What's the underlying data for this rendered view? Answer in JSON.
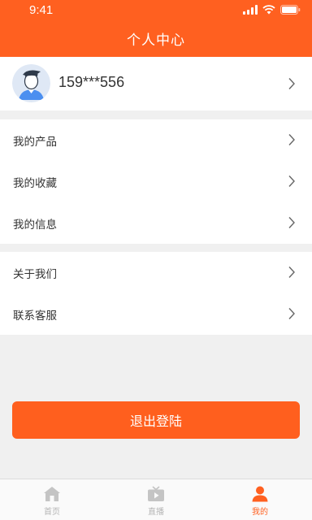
{
  "status_bar": {
    "time": "9:41"
  },
  "header": {
    "title": "个人中心"
  },
  "profile": {
    "phone": "159***556"
  },
  "menu_group_1": {
    "items": [
      {
        "label": "我的产品"
      },
      {
        "label": "我的收藏"
      },
      {
        "label": "我的信息"
      }
    ]
  },
  "menu_group_2": {
    "items": [
      {
        "label": "关于我们"
      },
      {
        "label": "联系客服"
      }
    ]
  },
  "logout": {
    "label": "退出登陆"
  },
  "tab_bar": {
    "tabs": [
      {
        "label": "首页",
        "icon": "home-icon",
        "active": false
      },
      {
        "label": "直播",
        "icon": "tv-icon",
        "active": false
      },
      {
        "label": "我的",
        "icon": "user-icon",
        "active": true
      }
    ]
  },
  "colors": {
    "accent": "#ff6020",
    "background": "#f0f0f0",
    "inactive_tab": "#b5b5b5"
  }
}
